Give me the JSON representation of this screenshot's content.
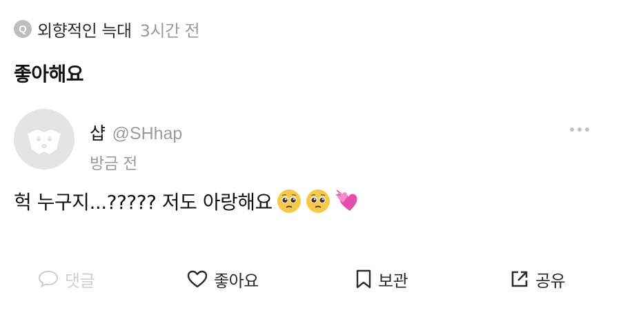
{
  "question": {
    "badge_letter": "Q",
    "author": "외향적인 늑대",
    "time": "3시간 전",
    "text": "좋아해요"
  },
  "answer": {
    "avatar_icon": "default-avatar-icon",
    "name": "샵",
    "handle": "@SHhap",
    "time": "방금 전",
    "text": "헉 누구지...????? 저도 아랑해요",
    "emojis": [
      "pleading-face-emoji",
      "pleading-face-emoji",
      "two-hearts-emoji"
    ],
    "more_icon": "more-dots-icon"
  },
  "actions": {
    "comment": {
      "label": "댓글",
      "icon": "speech-bubble-icon",
      "color": "#cfcfcf"
    },
    "like": {
      "label": "좋아요",
      "icon": "heart-icon"
    },
    "save": {
      "label": "보관",
      "icon": "bookmark-icon"
    },
    "share": {
      "label": "공유",
      "icon": "share-icon"
    }
  },
  "colors": {
    "text_primary": "#111111",
    "text_secondary": "#9a9a9a",
    "badge": "#bdbdbd",
    "avatar_bg": "#e4e4e4",
    "heart_emoji": "#e34fa8",
    "face_emoji": "#f7c948"
  }
}
